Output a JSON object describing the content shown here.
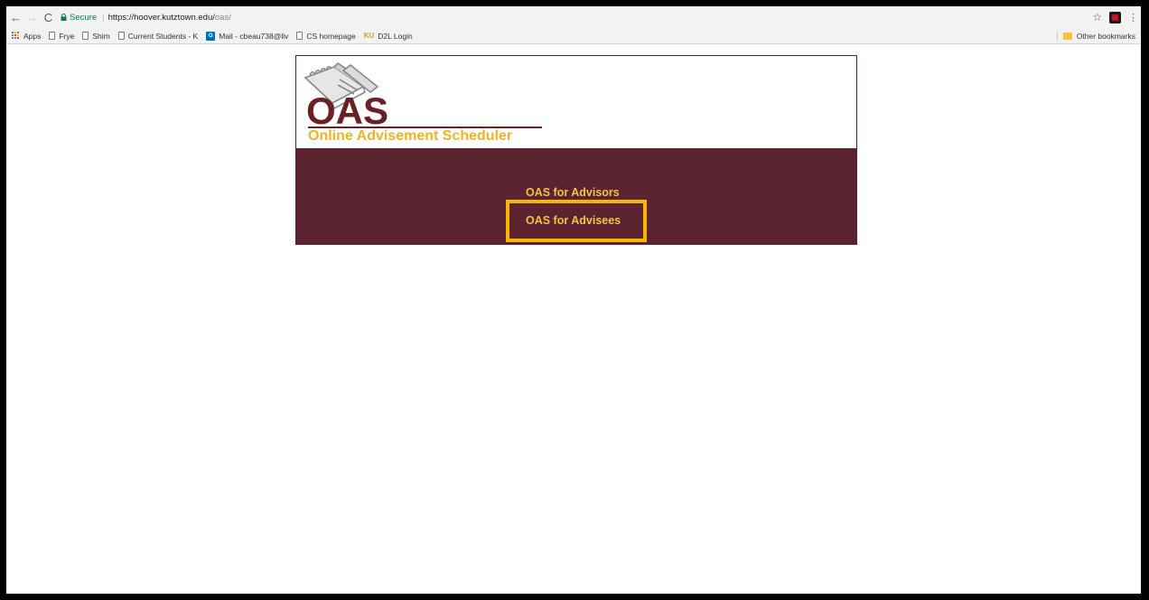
{
  "browser": {
    "back_label": "←",
    "forward_label": "→",
    "reload_label": "C",
    "secure_label": "Secure",
    "url_host": "https://hoover.kutztown.edu/",
    "url_path": "oas/",
    "star_label": "☆",
    "menu_label": "⋮"
  },
  "bookmarks": {
    "items": [
      {
        "label": "Apps",
        "icon": "apps-grid-icon"
      },
      {
        "label": "Frye",
        "icon": "page-icon"
      },
      {
        "label": "Shim",
        "icon": "page-icon"
      },
      {
        "label": "Current Students - K",
        "icon": "page-icon"
      },
      {
        "label": "Mail - cbeau738@liv",
        "icon": "outlook-icon"
      },
      {
        "label": "CS homepage",
        "icon": "page-icon"
      },
      {
        "label": "D2L Login",
        "icon": "ku-icon"
      }
    ],
    "outlook_badge": "O",
    "ku_badge": "KU",
    "other_label": "Other bookmarks"
  },
  "page": {
    "logo_text": "OAS",
    "subtitle": "Online Advisement Scheduler",
    "links": {
      "advisors": "OAS for Advisors",
      "advisees": "OAS for Advisees"
    }
  },
  "colors": {
    "maroon": "#5b2330",
    "logo_maroon": "#6b2024",
    "gold": "#f5c342",
    "highlight": "#f5b800"
  }
}
